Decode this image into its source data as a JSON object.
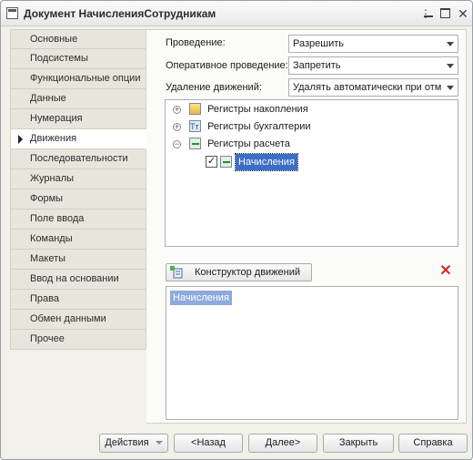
{
  "window": {
    "title": "Документ НачисленияСотрудникам"
  },
  "sections": [
    {
      "label": "Основные"
    },
    {
      "label": "Подсистемы"
    },
    {
      "label": "Функциональные опции"
    },
    {
      "label": "Данные"
    },
    {
      "label": "Нумерация"
    },
    {
      "label": "Движения",
      "active": true
    },
    {
      "label": "Последовательности"
    },
    {
      "label": "Журналы"
    },
    {
      "label": "Формы"
    },
    {
      "label": "Поле ввода"
    },
    {
      "label": "Команды"
    },
    {
      "label": "Макеты"
    },
    {
      "label": "Ввод на основании"
    },
    {
      "label": "Права"
    },
    {
      "label": "Обмен данными"
    },
    {
      "label": "Прочее"
    }
  ],
  "form": {
    "posting_label": "Проведение:",
    "posting_value": "Разрешить",
    "realtime_label": "Оперативное проведение:",
    "realtime_value": "Запретить",
    "delete_label": "Удаление движений:",
    "delete_value": "Удалять автоматически при отм"
  },
  "tree": {
    "items": [
      {
        "label": "Регистры накопления",
        "expander": "+"
      },
      {
        "label": "Регистры бухгалтерии",
        "expander": "+"
      },
      {
        "label": "Регистры расчета",
        "expander": "−"
      },
      {
        "label": "Начисления",
        "checked": true,
        "check_mark": "✓"
      }
    ]
  },
  "register_records": {
    "constructor_button": "Конструктор движений",
    "delete_icon": "red-cross",
    "items": [
      "Начисления"
    ]
  },
  "footer": {
    "actions": "Действия",
    "back": "<Назад",
    "next": "Далее>",
    "close": "Закрыть",
    "help": "Справка"
  }
}
